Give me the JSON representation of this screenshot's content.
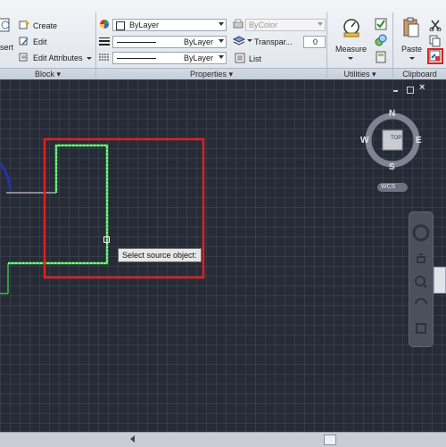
{
  "ribbon": {
    "block": {
      "insert_label": "sert",
      "create_label": "Create",
      "edit_label": "Edit",
      "edit_attributes_label": "Edit Attributes",
      "panel_label": "Block"
    },
    "properties": {
      "layer_value": "ByLayer",
      "linetype_value": "ByLayer",
      "lineweight_value": "ByLayer",
      "plotstyle_value": "ByColor",
      "transparency_label": "Transpar...",
      "transparency_value": "0",
      "list_label": "List",
      "panel_label": "Properties"
    },
    "utilities": {
      "measure_label": "Measure",
      "panel_label": "Utilities"
    },
    "clipboard": {
      "paste_label": "Paste",
      "panel_label": "Clipboard"
    }
  },
  "viewcube": {
    "north": "N",
    "south": "S",
    "east": "E",
    "west": "W",
    "face_label": "TOP",
    "wcs_label": "WCS"
  },
  "drawing": {
    "tooltip_text": "Select source object:"
  },
  "colors": {
    "highlight_red": "#e02020",
    "selected_green": "#3de04a",
    "canvas_bg": "#272b36"
  }
}
